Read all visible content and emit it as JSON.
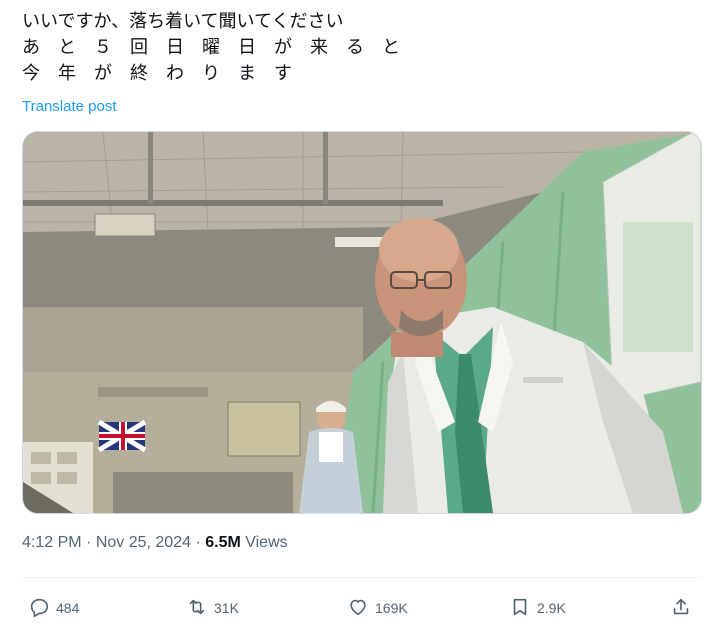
{
  "post": {
    "lines": [
      "いいですか、落ち着いて聞いてください",
      "あ　と　５　回　日　曜　日　が　来　る　と",
      "今　年　が　終　わ　り　ま　す"
    ],
    "translate_label": "Translate post"
  },
  "meta": {
    "time": "4:12 PM",
    "separator1": " · ",
    "date": "Nov 25, 2024",
    "separator2": " · ",
    "views_count": "6.5M",
    "views_label": " Views"
  },
  "actions": {
    "replies": "484",
    "reposts": "31K",
    "likes": "169K",
    "bookmarks": "2.9K"
  },
  "colors": {
    "text": "#0f1419",
    "secondary": "#536471",
    "link": "#1d9bf0",
    "border": "#cfd9de"
  },
  "icons": [
    "reply-icon",
    "repost-icon",
    "like-icon",
    "bookmark-icon",
    "share-icon"
  ]
}
